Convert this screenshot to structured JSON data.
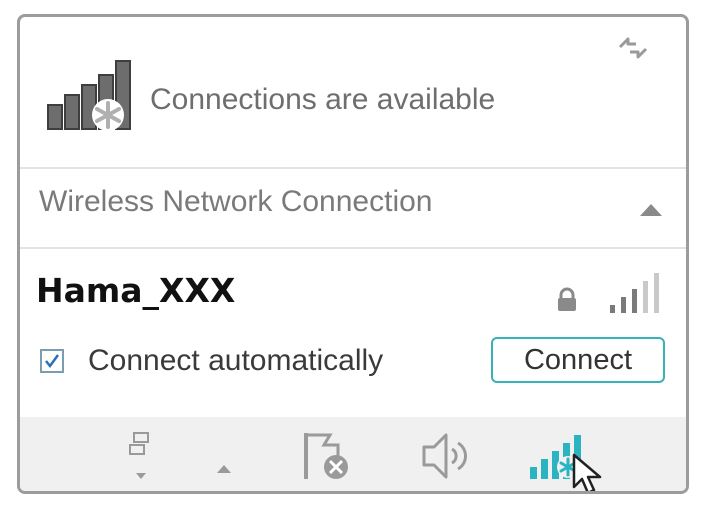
{
  "header": {
    "status_text": "Connections are available",
    "status_icon": "wifi-signal-star-icon",
    "refresh_icon": "refresh-icon"
  },
  "section": {
    "title": "Wireless Network Connection",
    "collapse_icon": "caret-up-icon"
  },
  "network": {
    "ssid": "Hama_XXX",
    "secured": true,
    "signal_bars": 5,
    "signal_strength": 0.6,
    "connect_automatically_label": "Connect automatically",
    "connect_automatically_checked": true,
    "connect_button_label": "Connect"
  },
  "taskbar": {
    "icons": [
      "network-icon",
      "show-hidden-icons-arrow",
      "action-center-flag-icon",
      "volume-icon",
      "wifi-signal-icon",
      "mouse-cursor-icon"
    ]
  },
  "colors": {
    "accent": "#3ab0b8",
    "wifi_active": "#2ab3c0",
    "icon_gray": "#6d6d6d",
    "taskbar_bg": "#f0f0f0"
  }
}
